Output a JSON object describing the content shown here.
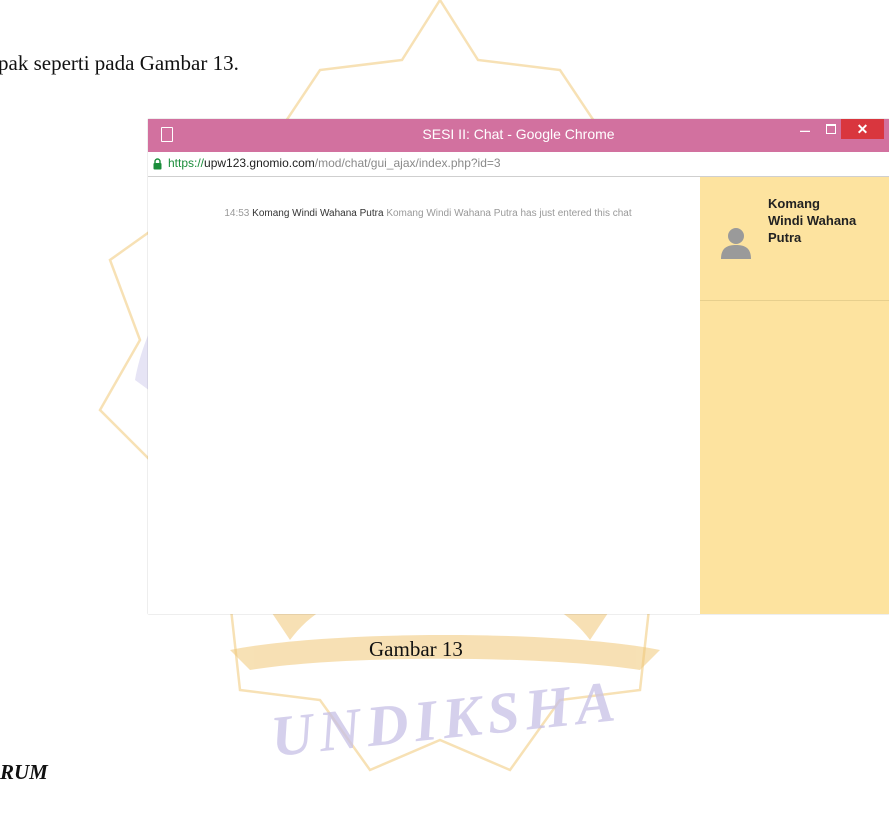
{
  "document": {
    "line_top": "pak seperti pada Gambar 13.",
    "caption": "Gambar 13",
    "section_heading": "RUM",
    "watermark_text": "UNDIKSHA"
  },
  "browser": {
    "window_title": "SESI II: Chat - Google Chrome",
    "url_scheme": "https://",
    "url_host": "upw123.gnomio.com",
    "url_path": "/mod/chat/gui_ajax/index.php?id=3",
    "minimize_label": "–",
    "close_label": "✕",
    "colors": {
      "titlebar": "#d2719f",
      "close": "#d9363e",
      "users_panel": "#fde39f"
    }
  },
  "chat": {
    "messages": [
      {
        "time": "14:53",
        "user": "Komang Windi Wahana Putra",
        "text": "Komang Windi Wahana Putra has just entered this chat"
      }
    ]
  },
  "users": {
    "list": [
      {
        "name": "Komang Windi Wahana Putra",
        "icon": "user-avatar-icon"
      }
    ]
  }
}
